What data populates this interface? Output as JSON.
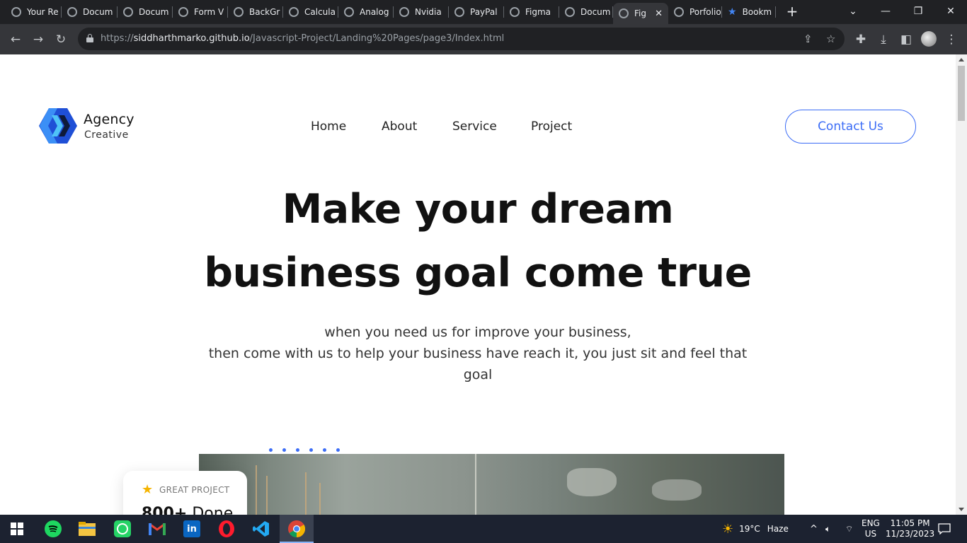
{
  "browser": {
    "tabs": [
      {
        "title": "Your Re",
        "icon": "github-icon"
      },
      {
        "title": "Docum",
        "icon": "globe-icon"
      },
      {
        "title": "Docum",
        "icon": "globe-icon"
      },
      {
        "title": "Form V",
        "icon": "globe-icon"
      },
      {
        "title": "BackGr",
        "icon": "globe-icon"
      },
      {
        "title": "Calcula",
        "icon": "globe-icon"
      },
      {
        "title": "Analog",
        "icon": "globe-icon"
      },
      {
        "title": "Nvidia",
        "icon": "globe-icon"
      },
      {
        "title": "PayPal",
        "icon": "globe-icon"
      },
      {
        "title": "Figma",
        "icon": "globe-icon"
      },
      {
        "title": "Docum",
        "icon": "globe-icon"
      },
      {
        "title": "Fig",
        "icon": "globe-icon",
        "active": true
      },
      {
        "title": "Porfolio",
        "icon": "globe-icon"
      },
      {
        "title": "Bookm",
        "icon": "star-icon"
      }
    ],
    "url_prefix": "https://",
    "url_host": "siddharthmarko.github.io",
    "url_path": "/Javascript-Project/Landing%20Pages/page3/Index.html"
  },
  "site": {
    "brand_name": "Agency",
    "brand_tagline": "Creative",
    "nav": [
      "Home",
      "About",
      "Service",
      "Project"
    ],
    "contact_label": "Contact Us",
    "hero_line1": "Make your dream",
    "hero_line2": "business goal come true",
    "sub_line1": "when you need us for improve your business,",
    "sub_line2": "then come with us to help your business have reach it, you just sit and feel that",
    "sub_line3": "goal",
    "card_label": "GREAT PROJECT",
    "card_number": "800+",
    "card_number_suffix": "Done",
    "accent_color": "#3b6cf6"
  },
  "taskbar": {
    "weather_temp": "19°C",
    "weather_desc": "Haze",
    "lang_line1": "ENG",
    "lang_line2": "US",
    "time": "11:05 PM",
    "date": "11/23/2023"
  }
}
